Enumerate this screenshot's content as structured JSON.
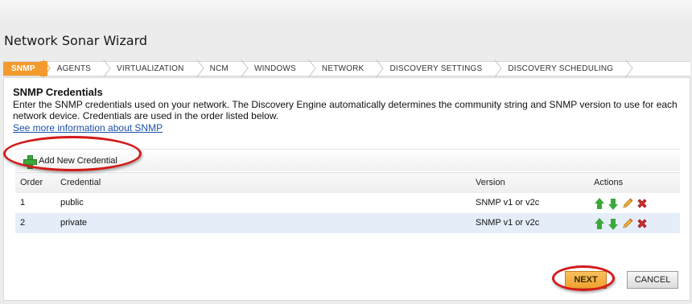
{
  "window": {
    "title": "Network Sonar Wizard"
  },
  "breadcrumb": {
    "steps": [
      {
        "label": "SNMP",
        "active": true
      },
      {
        "label": "AGENTS",
        "active": false
      },
      {
        "label": "VIRTUALIZATION",
        "active": false
      },
      {
        "label": "NCM",
        "active": false
      },
      {
        "label": "WINDOWS",
        "active": false
      },
      {
        "label": "NETWORK",
        "active": false
      },
      {
        "label": "DISCOVERY SETTINGS",
        "active": false
      },
      {
        "label": "DISCOVERY SCHEDULING",
        "active": false
      }
    ]
  },
  "main": {
    "section_title": "SNMP Credentials",
    "description": "Enter the SNMP credentials used on your network. The Discovery Engine automatically determines the community string and SNMP version to use for each network device. Credentials are used in the order listed below.",
    "more_link": "See more information about SNMP",
    "add_button": "Add New Credential",
    "table": {
      "headers": {
        "order": "Order",
        "credential": "Credential",
        "version": "Version",
        "actions": "Actions"
      },
      "rows": [
        {
          "order": "1",
          "credential": "public",
          "version": "SNMP v1 or v2c"
        },
        {
          "order": "2",
          "credential": "private",
          "version": "SNMP v1 or v2c"
        }
      ]
    }
  },
  "footer": {
    "next_label": "NEXT",
    "cancel_label": "CANCEL"
  },
  "icons": {
    "add": "plus-icon",
    "move_up": "arrow-up-icon",
    "move_down": "arrow-down-icon",
    "edit": "pencil-icon",
    "delete": "x-icon"
  },
  "colors": {
    "accent": "#f29b2c",
    "link": "#1a50a8",
    "row_alt": "#e5eef8",
    "annotation": "#d21a1a",
    "icon_green": "#3aa83a"
  }
}
